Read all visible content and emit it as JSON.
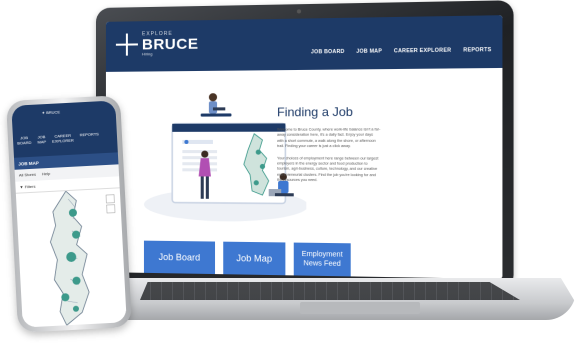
{
  "laptop": {
    "logo": {
      "top": "EXPLORE",
      "main": "BRUCE",
      "sub": "Hiring"
    },
    "nav": [
      "JOB BOARD",
      "JOB MAP",
      "CAREER EXPLORER",
      "REPORTS"
    ],
    "hero": {
      "title": "Finding a Job",
      "paragraph1": "Welcome to Bruce County, where work-life balance isn't a far-away consideration here, it's a daily fact. Enjoy your days with a short commute, a walk along the shore, or afternoon trail. Finding your career is just a click away.",
      "paragraph2": "Your choices of employment here range between our largest employers in the energy sector and food production to tourism, agri-business, culture, technology, and our creative entrepreneurial clusters. Find the job you're looking for and the resources you need."
    },
    "buttons": {
      "job_board": "Job Board",
      "job_map": "Job Map",
      "employment_news": "Employment News Feed"
    }
  },
  "phone": {
    "nav": [
      "JOB\nBOARD",
      "JOB\nMAP",
      "CAREER\nEXPLORER",
      "REPORTS"
    ],
    "section_title": "JOB MAP",
    "tools": [
      "All Stores",
      "Help"
    ],
    "filters_label": "Filters"
  },
  "colors": {
    "brand_navy": "#1d3a67",
    "button_blue": "#3e78d1",
    "map_teal": "#3d9a8b"
  }
}
